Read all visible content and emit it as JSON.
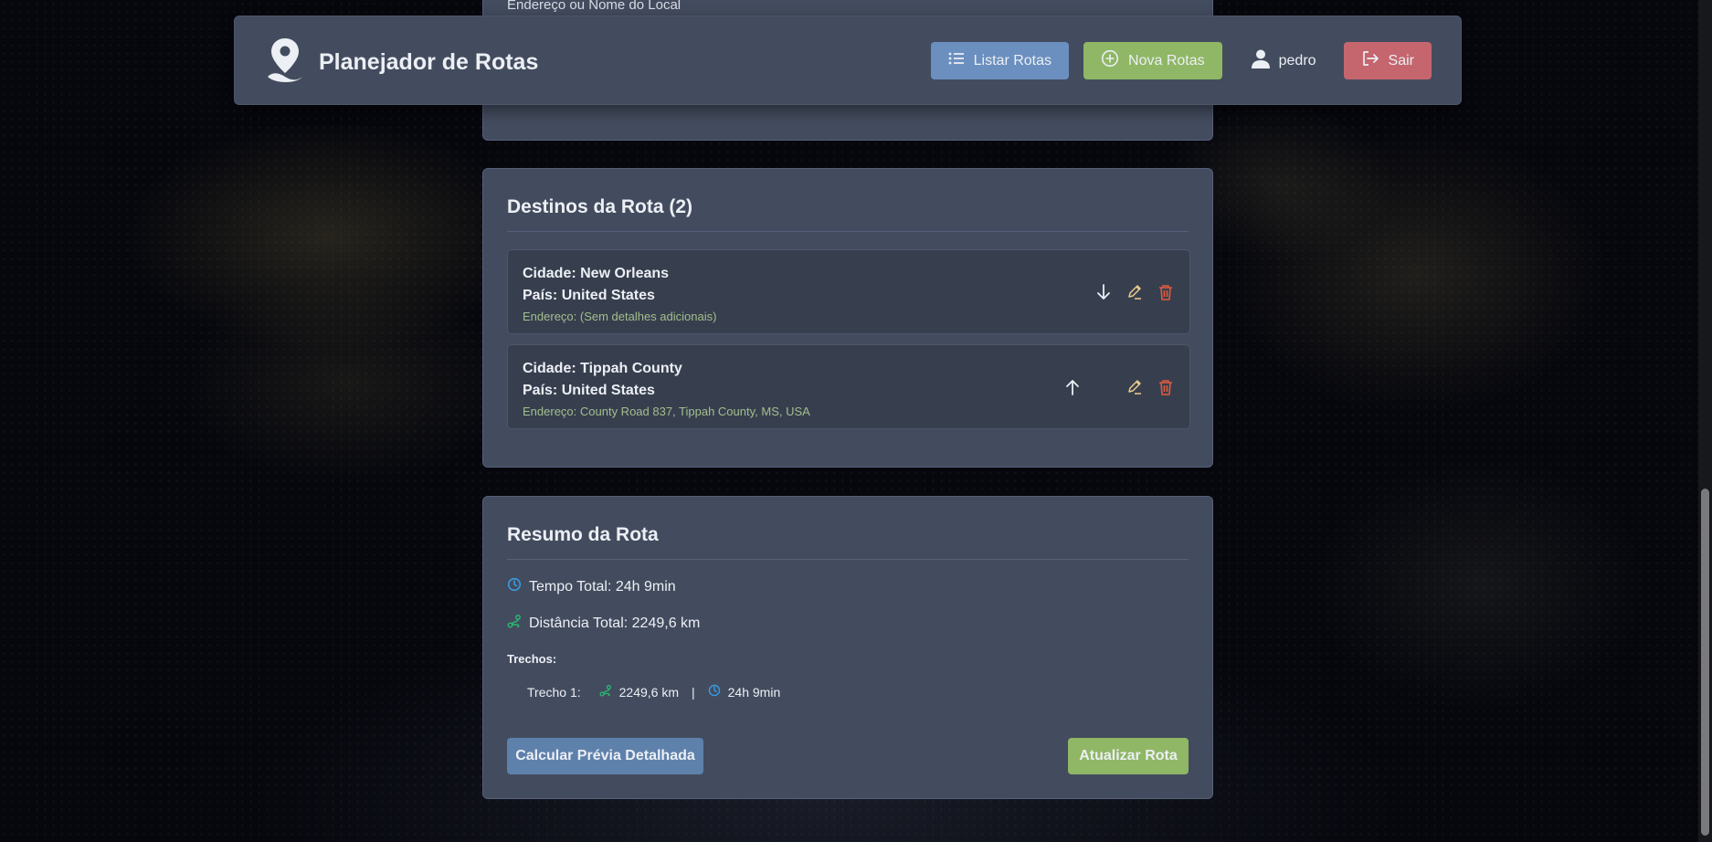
{
  "header": {
    "title": "Planejador de Rotas",
    "logo_icon": "map-pin-icon",
    "nav": {
      "list_label": "Listar Rotas",
      "new_label": "Nova Rotas",
      "user_name": "pedro",
      "logout_label": "Sair"
    }
  },
  "top_card": {
    "field_label": "Endereço ou Nome do Local"
  },
  "destinations": {
    "title": "Destinos da Rota (2)",
    "items": [
      {
        "city": "Cidade: New Orleans",
        "country": "País: United States",
        "address": "Endereço: (Sem detalhes adicionais)",
        "move_icon": "arrow-down-icon"
      },
      {
        "city": "Cidade: Tippah County",
        "country": "País: United States",
        "address": "Endereço: County Road 837, Tippah County, MS, USA",
        "move_icon": "arrow-up-icon"
      }
    ]
  },
  "summary": {
    "title": "Resumo da Rota",
    "total_time": "Tempo Total: 24h 9min",
    "total_distance": "Distância Total: 2249,6 km",
    "segments_label": "Trechos:",
    "segments": [
      {
        "label": "Trecho 1:",
        "distance": "2249,6 km",
        "separator": "|",
        "time": "24h 9min"
      }
    ],
    "preview_button": "Calcular Prévia Detalhada",
    "update_button": "Atualizar Rota"
  },
  "colors": {
    "card_bg": "#434c5e",
    "item_bg": "#373f4f",
    "primary": "#5e81ac",
    "success": "#8fb765",
    "danger": "#c5666e",
    "edit": "#ebcb8b",
    "delete": "#e05a3a",
    "clock": "#3b9ae1",
    "route": "#2bb673",
    "address_text": "#a3be8c"
  }
}
